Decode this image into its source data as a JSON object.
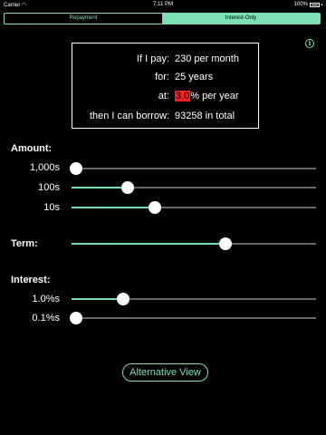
{
  "status_bar": {
    "carrier": "Carrier",
    "wifi_icon": "wifi-icon",
    "time": "7:11 PM",
    "battery": "100%"
  },
  "tabs": [
    {
      "label": "Repayment",
      "selected": false
    },
    {
      "label": "Interest-Only",
      "selected": true
    }
  ],
  "info_icon": "info-icon",
  "summary": {
    "pay_label": "If I pay:",
    "pay_value": "230 per month",
    "for_label": "for:",
    "for_value": "25 years",
    "at_label": "at:",
    "rate_value": "3.0",
    "rate_unit": "% per year",
    "borrow_label": "then I can borrow:",
    "borrow_value": "93258 in total"
  },
  "amount": {
    "title": "Amount:",
    "sliders": [
      {
        "label": "1,000s",
        "position": 0.02
      },
      {
        "label": "100s",
        "position": 0.23
      },
      {
        "label": "10s",
        "position": 0.34
      }
    ]
  },
  "term": {
    "title": "Term:",
    "position": 0.63
  },
  "interest": {
    "title": "Interest:",
    "sliders": [
      {
        "label": "1.0%s",
        "position": 0.21
      },
      {
        "label": "0.1%s",
        "position": 0.02
      }
    ]
  },
  "alt_button": "Alternative View",
  "colors": {
    "accent": "#7de0b5",
    "highlight": "#ff2020",
    "background": "#000000"
  }
}
